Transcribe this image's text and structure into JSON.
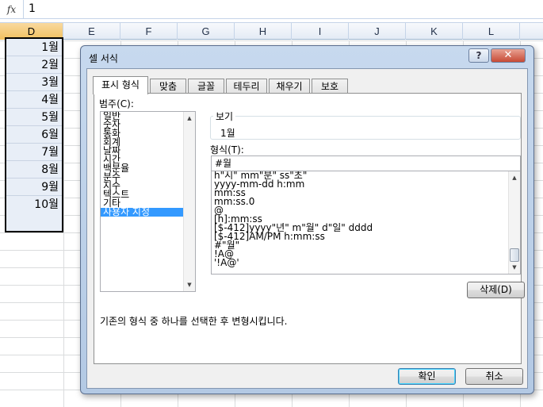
{
  "formula_bar": {
    "fx": "fx",
    "value": "1"
  },
  "sheet": {
    "columns": [
      "D",
      "E",
      "F",
      "G",
      "H",
      "I",
      "J",
      "K",
      "L"
    ],
    "selected_column": "D",
    "months": [
      "1월",
      "2월",
      "3월",
      "4월",
      "5월",
      "6월",
      "7월",
      "8월",
      "9월",
      "10월"
    ]
  },
  "dialog": {
    "title": "셀 서식",
    "help_label": "?",
    "close_label": "✕",
    "tabs": [
      "표시 형식",
      "맞춤",
      "글꼴",
      "테두리",
      "채우기",
      "보호"
    ],
    "active_tab": "표시 형식",
    "category_label": "범주(C):",
    "categories": [
      "일반",
      "숫자",
      "통화",
      "회계",
      "날짜",
      "시간",
      "백분율",
      "분수",
      "지수",
      "텍스트",
      "기타",
      "사용자 지정"
    ],
    "selected_category": "사용자 지정",
    "sample_label": "보기",
    "sample_value": "1월",
    "type_label": "형식(T):",
    "type_value": "#월",
    "formats": [
      "h\"시\" mm\"분\" ss\"초\"",
      "yyyy-mm-dd h:mm",
      "mm:ss",
      "mm:ss.0",
      "@",
      "[h]:mm:ss",
      "[$-412]yyyy\"년\" m\"월\" d\"일\" dddd",
      "[$-412]AM/PM h:mm:ss",
      "#\"월\"",
      "!A@",
      "'!A@'"
    ],
    "delete_label": "삭제(D)",
    "description": "기존의 형식 중 하나를 선택한 후 변형시킵니다.",
    "ok_label": "확인",
    "cancel_label": "취소"
  }
}
